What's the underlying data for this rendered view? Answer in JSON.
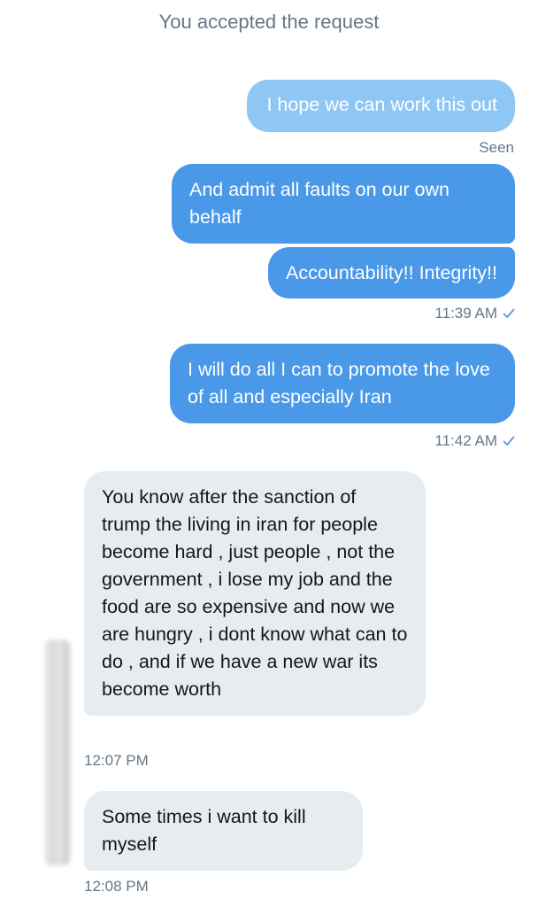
{
  "conversation": {
    "system_note": "You accepted the request",
    "messages": [
      {
        "text": "I hope we can work this out",
        "status": "Seen"
      },
      {
        "text": "And admit all faults on our own behalf"
      },
      {
        "text": "Accountability!! Integrity!!",
        "time": "11:39 AM"
      },
      {
        "text": "I will do all I can to promote the love of all and especially Iran",
        "time": "11:42 AM"
      },
      {
        "text": "You know after the sanction of trump the living in iran for people become hard , just people , not the government , i lose my job and the food are so expensive and now we are hungry , i dont know what can to do , and if we have a new war its become worth",
        "time": "12:07 PM"
      },
      {
        "text": "Some times i want to kill myself",
        "time": "12:08 PM"
      }
    ]
  },
  "colors": {
    "outgoing_bubble": "#4a99e9",
    "outgoing_bubble_faded": "#8ec6f4",
    "incoming_bubble": "#e6ecf0",
    "meta_text": "#657786",
    "read_check": "#4a99e9"
  },
  "icons": {
    "read_receipt": "checkmark-icon"
  }
}
